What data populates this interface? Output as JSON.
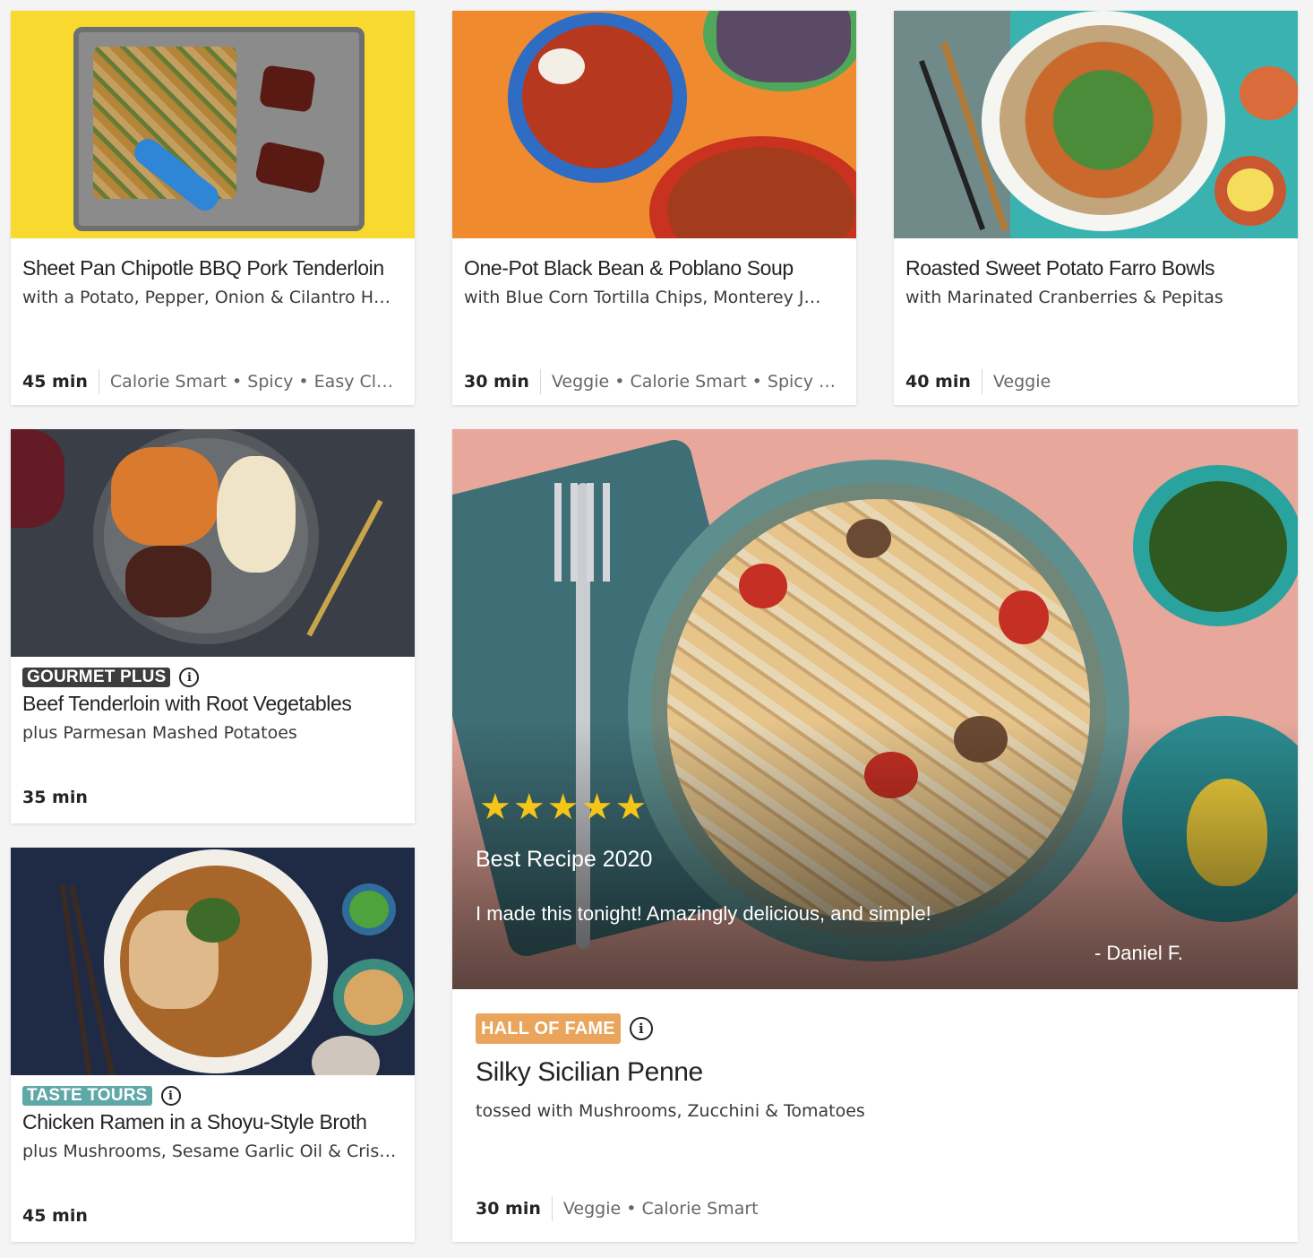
{
  "cards": [
    {
      "title": "Sheet Pan Chipotle BBQ Pork Tenderloin",
      "subtitle": "with a Potato, Pepper, Onion & Cilantro H…",
      "time": "45 min",
      "tags": "Calorie Smart • Spicy • Easy Cl…"
    },
    {
      "title": "One-Pot Black Bean & Poblano Soup",
      "subtitle": "with Blue Corn Tortilla Chips, Monterey J…",
      "time": "30 min",
      "tags": "Veggie • Calorie Smart • Spicy •…"
    },
    {
      "title": "Roasted Sweet Potato Farro Bowls",
      "subtitle": "with Marinated Cranberries & Pepitas",
      "time": "40 min",
      "tags": "Veggie"
    },
    {
      "badge": "GOURMET PLUS",
      "badge_color": "#3d3d3d",
      "title": "Beef Tenderloin with Root Vegetables",
      "subtitle": "plus Parmesan Mashed Potatoes",
      "time": "35 min"
    },
    {
      "badge": "TASTE TOURS",
      "badge_color": "#5fa8a8",
      "title": "Chicken Ramen in a Shoyu-Style Broth",
      "subtitle": "plus Mushrooms, Sesame Garlic Oil & Cris…",
      "time": "45 min"
    }
  ],
  "featured": {
    "rating_stars": 5,
    "stars": "★★★★★",
    "review_title": "Best Recipe 2020",
    "review_text": "I made this tonight! Amazingly delicious, and simple!",
    "review_author": "- Daniel F.",
    "badge": "HALL OF FAME",
    "badge_color": "#e8a55b",
    "title": "Silky Sicilian Penne",
    "subtitle": "tossed with Mushrooms, Zucchini & Tomatoes",
    "time": "30 min",
    "tags": "Veggie • Calorie Smart"
  },
  "icons": {
    "info": "i"
  }
}
